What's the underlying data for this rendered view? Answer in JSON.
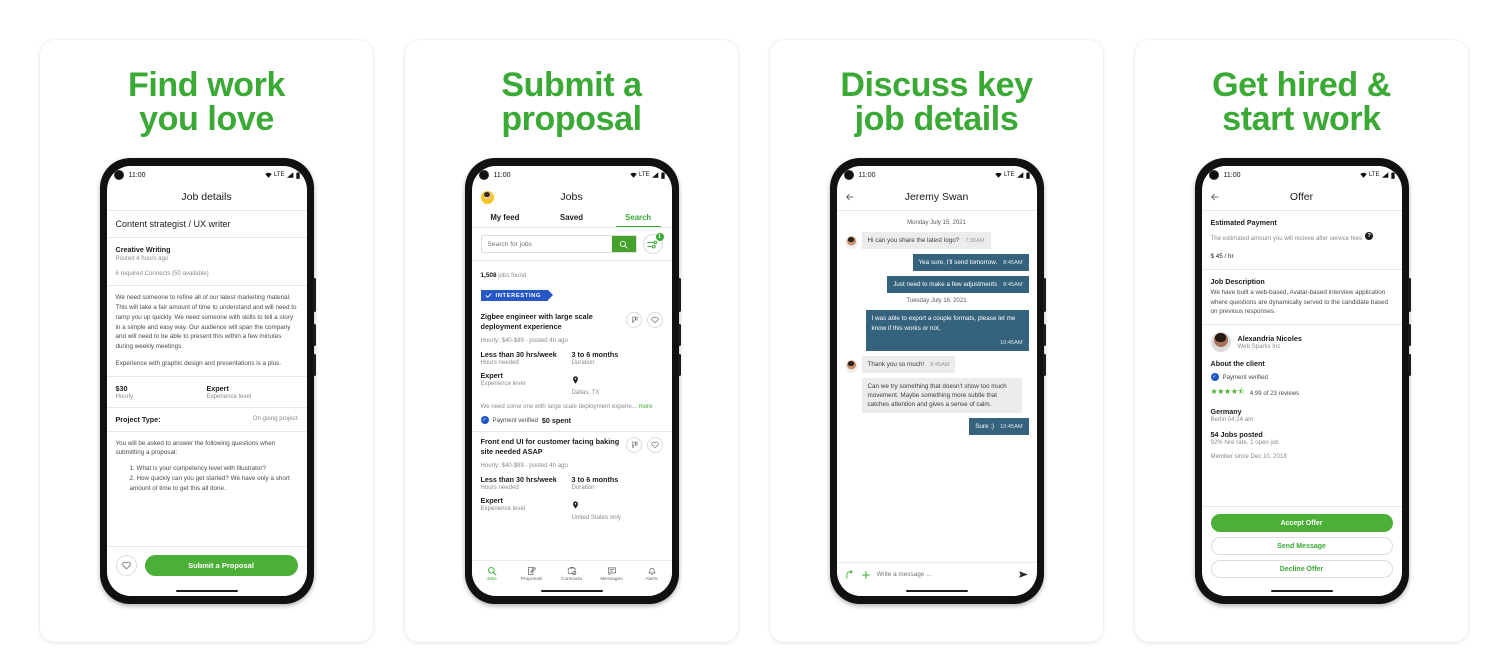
{
  "cards": [
    {
      "title": "Find work\nyou love"
    },
    {
      "title": "Submit a\nproposal"
    },
    {
      "title": "Discuss key\njob details"
    },
    {
      "title": "Get hired &\nstart work"
    }
  ],
  "status_bar": {
    "time": "11:00",
    "network": "LTE"
  },
  "phone1": {
    "app_title": "Job details",
    "job_title": "Content strategist / UX writer",
    "category": "Creative Writing",
    "posted": "Posted 4 hours ago",
    "connects": "6 required Connects (50 available)",
    "description_p1": "We need someone to refine all of our latest marketing material. This will take a fair amount of time to understand and will need to ramp you up quickly. We need someone with skills to tell a story in a simple and easy way. Our audience will span the company and will need to be able to present this within a few minutes during weekly meetings.",
    "description_p2": "Experience with graphic design and presentations is a plus.",
    "rate_value": "$30",
    "rate_label": "Hourly",
    "level_value": "Expert",
    "level_label": "Experience level",
    "project_type_label": "Project Type:",
    "project_type_value": "On going project",
    "questions_intro": "You will be asked to answer the following questions when submitting a proposal:",
    "questions": [
      "1. What is your competency level with Illustrator?",
      "2. How quickly can you get started? We have only a short amount of time to get this all done."
    ],
    "submit_label": "Submit a Proposal"
  },
  "phone2": {
    "app_title": "Jobs",
    "tabs": [
      {
        "label": "My feed",
        "active": false
      },
      {
        "label": "Saved",
        "active": false
      },
      {
        "label": "Search",
        "active": true
      }
    ],
    "search_placeholder": "Search for jobs",
    "search_value": "",
    "filter_badge": "1",
    "results_count": "1,508",
    "results_suffix": " jobs found",
    "ribbon_label": "INTERESTING",
    "jobs": [
      {
        "title": "Zigbee engineer with large scale deployment experience",
        "rate": "Hourly: $40-$89 - posted 4h ago",
        "hours_value": "Less than 30 hrs/week",
        "hours_label": "Hours needed",
        "duration_value": "3 to 6 months",
        "duration_label": "Duration",
        "level_value": "Expert",
        "level_label": "Experience level",
        "location": "Dallas, TX",
        "snippet": "We need some one with large scale deployment experie...",
        "more_label": "more",
        "verified_label": "Payment verified",
        "spent_label": "$0 spent"
      },
      {
        "title": "Front end UI for customer facing baking site needed ASAP",
        "rate": "Hourly: $40-$89 - posted 4h ago",
        "hours_value": "Less than 30 hrs/week",
        "hours_label": "Hours needed",
        "duration_value": "3 to 6 months",
        "duration_label": "Duration",
        "level_value": "Expert",
        "level_label": "Experience level",
        "location": "United States only"
      }
    ],
    "nav": [
      {
        "label": "Jobs",
        "active": true
      },
      {
        "label": "Proposals",
        "active": false
      },
      {
        "label": "Contracts",
        "active": false
      },
      {
        "label": "Messages",
        "active": false
      },
      {
        "label": "Alerts",
        "active": false
      }
    ]
  },
  "phone3": {
    "contact_name": "Jeremy Swan",
    "day1": "Monday July 15, 2021",
    "day2": "Tuesday July 16, 2021",
    "messages": [
      {
        "from": "them",
        "text": "Hi can you share the latest logo?",
        "time": "7:30AM",
        "day": 1
      },
      {
        "from": "me",
        "text": "Yea sure, I'll send tomorrow.",
        "time": "8:45AM",
        "day": 1
      },
      {
        "from": "me",
        "text": "Just need to make a few adjustments",
        "time": "8:45AM",
        "day": 1
      },
      {
        "from": "me",
        "text": "I was able to export a couple formats, please let me know if this works or not,",
        "time": "10:45AM",
        "day": 2
      },
      {
        "from": "them",
        "text": "Thank you so much!",
        "time": "8:45AM",
        "day": 2
      },
      {
        "from": "them",
        "text": "Can we try something that doesn't show too much movement. Maybe something more subtle that catches attention and gives a sense of calm.",
        "time": "",
        "day": 2
      },
      {
        "from": "me",
        "text": "Sure :)",
        "time": "10:45AM",
        "day": 2
      }
    ],
    "composer_placeholder": "Write a message ..."
  },
  "phone4": {
    "app_title": "Offer",
    "payment_heading": "Estimated Payment",
    "payment_sub": "The estimated amount you will recieve after service fees",
    "payment_amount": "$ 45 / hr",
    "desc_heading": "Job Description",
    "desc_body": "We have built a web-based, Avatar-based interview application where questions are dynamically served to the candidate based on previous responses.",
    "client_name": "Alexandria Nicoles",
    "client_company": "Web Sparks Inc",
    "about_client": "About the client",
    "verified_label": "Payment verified",
    "stars": "★★★★",
    "half_star": "★",
    "reviews": "4.99 of 23 reviews",
    "country": "Germany",
    "city_time": "Berlin 04:24 am",
    "jobs_posted": "54 Jobs posted",
    "hire_rate": "92% hire rate, 1 open job",
    "member_since": "Member since Dec 10, 2018",
    "accept_label": "Accept Offer",
    "message_label": "Send Message",
    "decline_label": "Decline Offer"
  },
  "colors": {
    "brand_green": "#3aa935",
    "button_green": "#4caf38",
    "chat_bubble": "#35627c",
    "ribbon_blue": "#2557c7",
    "verified_blue": "#1a56c4"
  }
}
